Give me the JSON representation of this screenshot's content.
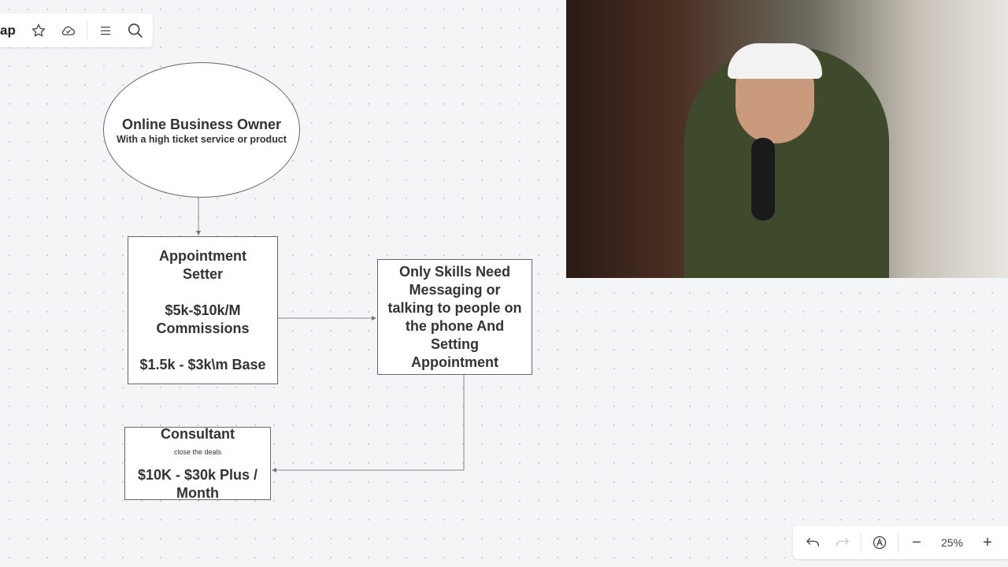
{
  "toolbar": {
    "title": "ap",
    "icons": [
      "star-icon",
      "cloud-check-icon",
      "menu-icon",
      "search-icon"
    ]
  },
  "shapes": {
    "owner": {
      "title": "Online Business Owner",
      "subtitle": "With a high ticket service or product"
    },
    "setter": {
      "line1": "Appointment",
      "line2": "Setter",
      "line3": "$5k-$10k/M",
      "line4": "Commissions",
      "line5": "$1.5k - $3k\\m Base"
    },
    "skills": {
      "lines": [
        "Only Skills Need",
        "Messaging or",
        "talking to people on",
        "the phone And",
        "Setting",
        "Appointment"
      ]
    },
    "consultant": {
      "title": "Consultant",
      "subtitle": "close the deals",
      "line1": "$10K - $30k Plus /",
      "line2": "Month"
    }
  },
  "zoom": {
    "level": "25%"
  }
}
